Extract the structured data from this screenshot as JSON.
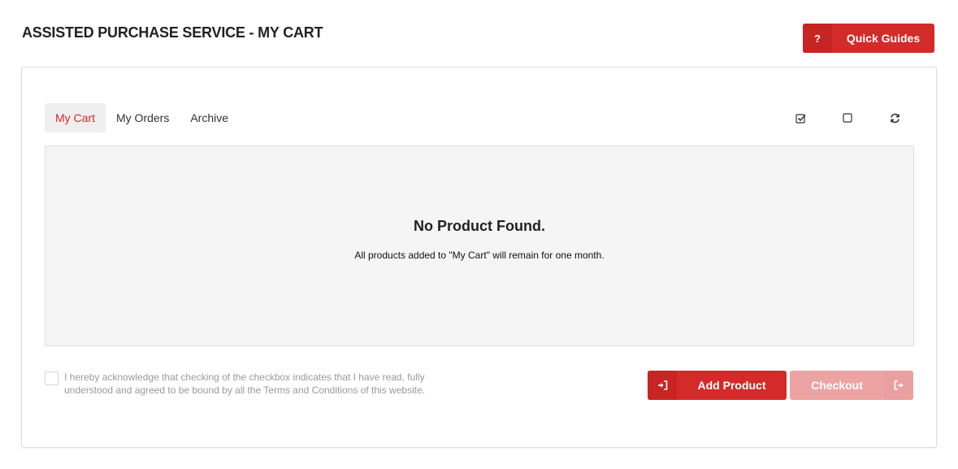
{
  "header": {
    "title": "ASSISTED PURCHASE SERVICE - MY CART",
    "quick_guides": {
      "icon": "?",
      "label": "Quick Guides"
    }
  },
  "tabs": [
    {
      "label": "My Cart",
      "active": true
    },
    {
      "label": "My Orders",
      "active": false
    },
    {
      "label": "Archive",
      "active": false
    }
  ],
  "toolbar": {
    "icons": [
      "check-all-icon",
      "uncheck-all-icon",
      "refresh-icon"
    ]
  },
  "cart": {
    "empty_title": "No Product Found.",
    "empty_message": "All products added to \"My Cart\" will remain for one month."
  },
  "footer": {
    "acknowledge_text": "I hereby acknowledge that checking of the checkbox indicates that I have read, fully understood and agreed to be bound by all the Terms and Conditions of this website.",
    "add_product_label": "Add Product",
    "checkout_label": "Checkout"
  },
  "colors": {
    "accent": "#d42a2a",
    "accent_disabled": "#eea3a3",
    "empty_bg": "#f5f5f5"
  }
}
